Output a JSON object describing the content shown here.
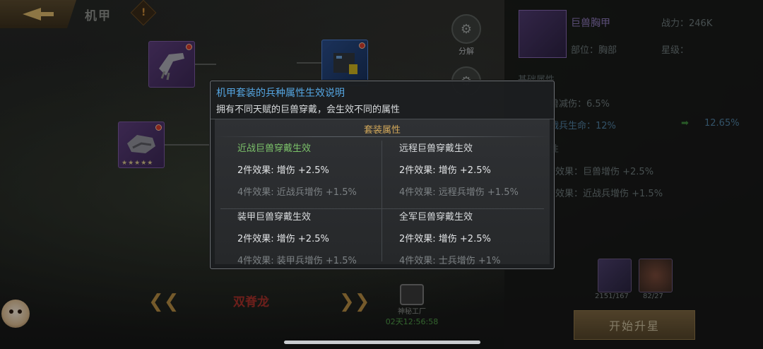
{
  "header": {
    "title": "机甲",
    "warn_symbol": "!"
  },
  "tools": [
    {
      "label": "分解",
      "icon": "gear-swords-icon"
    }
  ],
  "bottom": {
    "beast_name": "双脊龙",
    "factory_label": "神秘工厂",
    "factory_timer": "02天12:56:58",
    "prev_arrow": "❮❮",
    "next_arrow": "❯❯"
  },
  "item": {
    "name": "巨兽胸甲",
    "power": "战力：246K",
    "part": "部位：胸部",
    "star": "星级："
  },
  "attributes": {
    "base_header": "基础属性",
    "line1": "兽减伤：6.5%",
    "line2_label": "战兵生命：12%",
    "line2_next": "12.65%",
    "set_header": "性",
    "set_line1": "效果：巨兽增伤 +2.5%",
    "set_line2": "效果：近战兵增伤 +1.5%"
  },
  "materials": [
    {
      "count": "2151/167"
    },
    {
      "count": "82/27"
    }
  ],
  "star_up_button": "开始升星",
  "modal": {
    "title": "机甲套装的兵种属性生效说明",
    "description": "拥有不同天赋的巨兽穿戴，会生效不同的属性",
    "section_title": "套装属性",
    "cells": [
      {
        "heading": "近战巨兽穿戴生效",
        "active": true,
        "effect2": "2件效果: 增伤 +2.5%",
        "effect4": "4件效果: 近战兵增伤 +1.5%"
      },
      {
        "heading": "远程巨兽穿戴生效",
        "active": false,
        "effect2": "2件效果: 增伤 +2.5%",
        "effect4": "4件效果: 远程兵增伤 +1.5%"
      },
      {
        "heading": "装甲巨兽穿戴生效",
        "active": false,
        "effect2": "2件效果: 增伤 +2.5%",
        "effect4": "4件效果: 装甲兵增伤 +1.5%"
      },
      {
        "heading": "全军巨兽穿戴生效",
        "active": false,
        "effect2": "2件效果: 增伤 +2.5%",
        "effect4": "4件效果: 士兵增伤 +1%"
      }
    ]
  },
  "colors": {
    "active_heading": "#7cc36a",
    "title_blue": "#55a6e2",
    "section_gold": "#d2a85a"
  }
}
